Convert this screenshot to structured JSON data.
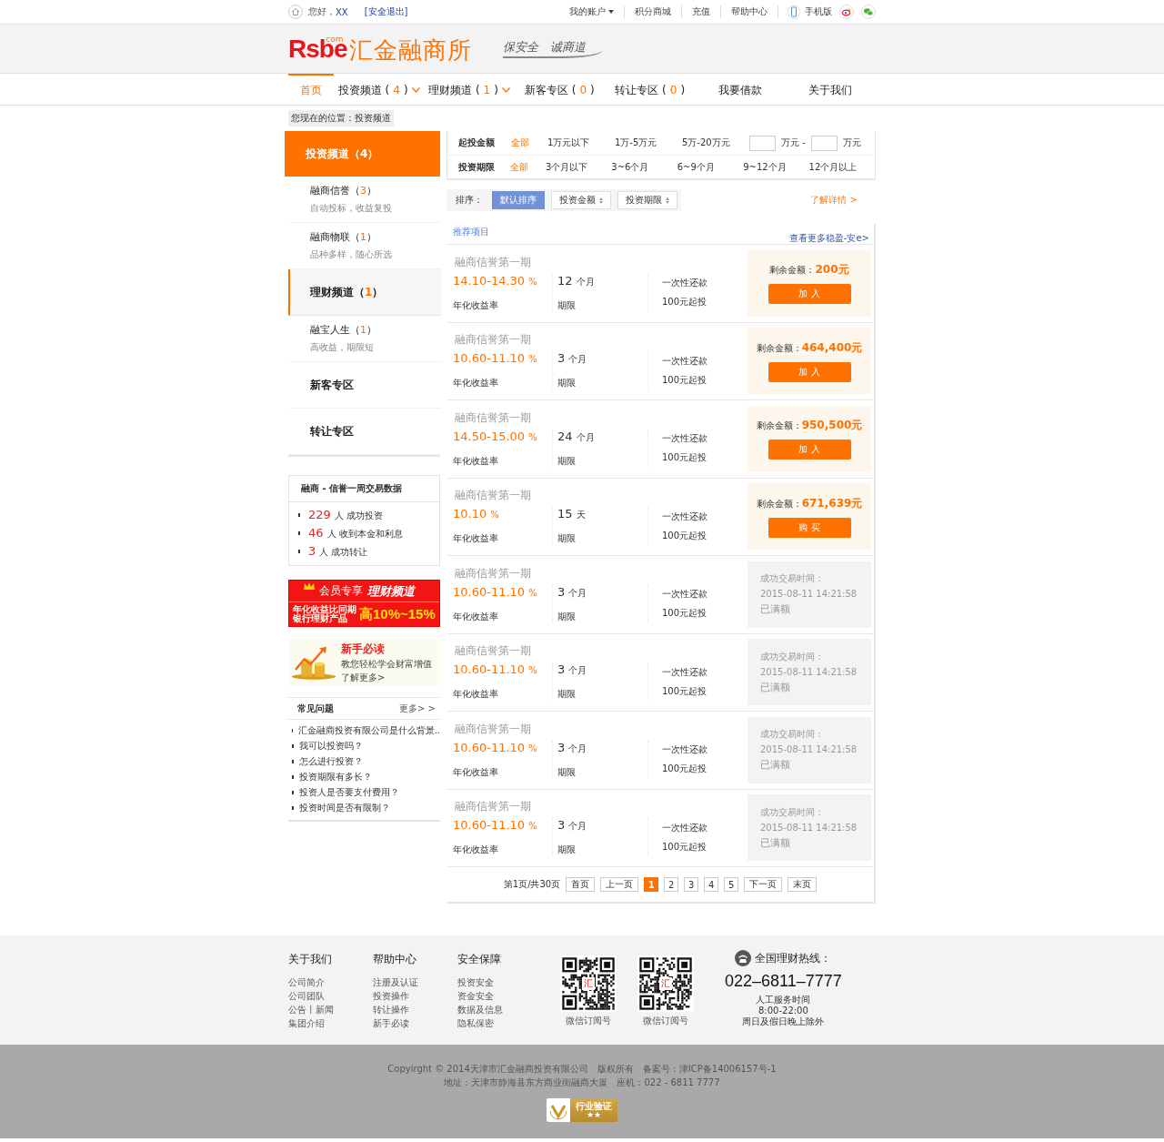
{
  "top_bar": {
    "greeting": "您好，",
    "user": "XX",
    "logout": "[安全退出]",
    "links": [
      {
        "label": "我的账户",
        "dropdown": true
      },
      {
        "label": "积分商城",
        "dropdown": false
      },
      {
        "label": "充值",
        "dropdown": false
      },
      {
        "label": "帮助中心",
        "dropdown": false
      }
    ],
    "mobile": "手机版"
  },
  "logo": {
    "brand": "Rsbe",
    "domain": ".com",
    "name": "汇金融商所",
    "slogan": "保安全　诚商道"
  },
  "nav": {
    "items": [
      {
        "label": "首页",
        "dropdown": false,
        "selected": true
      },
      {
        "label": "投资频道 (",
        "count": "4",
        "close": ")",
        "dropdown": true,
        "selected": false
      },
      {
        "label": "理财频道 (",
        "count": "1",
        "close": ")",
        "dropdown": true,
        "selected": false
      },
      {
        "label": "新客专区 (",
        "count": "0",
        "close": ")",
        "dropdown": false,
        "selected": false
      },
      {
        "label": "转让专区 (",
        "count": "0",
        "close": ")",
        "dropdown": false,
        "selected": false
      },
      {
        "label": "我要借款",
        "dropdown": false,
        "selected": false
      },
      {
        "label": "关于我们",
        "dropdown": false,
        "selected": false
      }
    ]
  },
  "breadcrumb": "您现在的位置：投资频道",
  "sidebar": {
    "header": {
      "label": "投资频道（",
      "count": "4",
      "close": "）"
    },
    "items": [
      {
        "kind": "sub",
        "title": "融商信誉（",
        "count": "3",
        "close": "）",
        "subtitle": "自动投标，收益复投",
        "selected": false
      },
      {
        "kind": "sub",
        "title": "融商物联（",
        "count": "1",
        "close": "）",
        "subtitle": "品种多样，随心所选",
        "selected": false
      },
      {
        "kind": "channel",
        "title": "理财频道（",
        "count": "1",
        "close": "）",
        "selected": true
      },
      {
        "kind": "sub",
        "title": "融宝人生（",
        "count": "1",
        "close": "）",
        "subtitle": "高收益，期限短",
        "selected": false
      },
      {
        "kind": "channel",
        "title": "新客专区",
        "selected": false
      },
      {
        "kind": "channel",
        "title": "转让专区",
        "selected": false
      }
    ]
  },
  "stats": {
    "title": "融商 - 信誉一周交易数据",
    "rows": [
      {
        "value": "229",
        "label": "人 成功投资"
      },
      {
        "value": "46",
        "label": "人 收到本金和利息"
      },
      {
        "value": "3",
        "label": "人 成功转让"
      }
    ]
  },
  "promo": {
    "tag": "会员专享",
    "title": "理财频道",
    "line1": "年化收益比同期",
    "line2": "银行理财产品",
    "highlight": "高10%~15%"
  },
  "guide": {
    "title": "新手必读",
    "text": "教您轻松学会财富增值",
    "link": "了解更多>"
  },
  "faq": {
    "title": "常见问题",
    "more": "更多> >",
    "items": [
      "汇金融商投资有限公司是什么背景..",
      "我可以投资吗？",
      "怎么进行投资？",
      "投资期限有多长？",
      "投资人是否要支付费用？",
      "投资时间是否有限制？"
    ]
  },
  "filters": [
    {
      "label": "起投金额",
      "options": [
        {
          "label": "全部",
          "selected": true
        },
        {
          "label": "1万元以下",
          "selected": false
        },
        {
          "label": "1万-5万元",
          "selected": false
        },
        {
          "label": "5万-20万元",
          "selected": false
        }
      ],
      "range": {
        "unit_from": "万元 -",
        "unit_to": "万元"
      }
    },
    {
      "label": "投资期限",
      "options": [
        {
          "label": "全部",
          "selected": true
        },
        {
          "label": "3个月以下",
          "selected": false
        },
        {
          "label": "3~6个月",
          "selected": false
        },
        {
          "label": "6~9个月",
          "selected": false
        },
        {
          "label": "9~12个月",
          "selected": false
        },
        {
          "label": "12个月以上",
          "selected": false
        }
      ]
    }
  ],
  "sort": {
    "label": "排序：",
    "buttons": [
      {
        "label": "默认排序",
        "selected": true,
        "arrows": false
      },
      {
        "label": "投资金额",
        "selected": false,
        "arrows": true
      },
      {
        "label": "投资期限",
        "selected": false,
        "arrows": true
      }
    ],
    "details_link": "了解详情 >"
  },
  "section": {
    "title": "推荐项目",
    "more": "查看更多稳盈-安e>"
  },
  "products": [
    {
      "name": "融商信誉第一期",
      "rate": "14.10-14.30",
      "rate_unit": "%",
      "rate_label": "年化收益率",
      "term": "12",
      "term_unit": "个月",
      "term_label": "期限",
      "repay": "一次性还款",
      "min": "100元起投",
      "status": {
        "kind": "open",
        "label": "剩余金额：",
        "amount": "200元",
        "button": "加 入"
      }
    },
    {
      "name": "融商信誉第一期",
      "rate": "10.60-11.10",
      "rate_unit": "%",
      "rate_label": "年化收益率",
      "term": "3",
      "term_unit": "个月",
      "term_label": "期限",
      "repay": "一次性还款",
      "min": "100元起投",
      "status": {
        "kind": "open",
        "label": "剩余金额：",
        "amount": "464,400元",
        "button": "加 入"
      }
    },
    {
      "name": "融商信誉第一期",
      "rate": "14.50-15.00",
      "rate_unit": "%",
      "rate_label": "年化收益率",
      "term": "24",
      "term_unit": "个月",
      "term_label": "期限",
      "repay": "一次性还款",
      "min": "100元起投",
      "status": {
        "kind": "open",
        "label": "剩余金额：",
        "amount": "950,500元",
        "button": "加 入"
      }
    },
    {
      "name": "融商信誉第一期",
      "rate": "10.10",
      "rate_unit": "%",
      "rate_label": "年化收益率",
      "term": "15",
      "term_unit": "天",
      "term_label": "期限",
      "repay": "一次性还款",
      "min": "100元起投",
      "status": {
        "kind": "open",
        "label": "剩余金额：",
        "amount": "671,639元",
        "button": "购 买"
      }
    },
    {
      "name": "融商信誉第一期",
      "rate": "10.60-11.10",
      "rate_unit": "%",
      "rate_label": "年化收益率",
      "term": "3",
      "term_unit": "个月",
      "term_label": "期限",
      "repay": "一次性还款",
      "min": "100元起投",
      "status": {
        "kind": "full",
        "label": "成功交易时间：",
        "time": "2015-08-11 14:21:58",
        "text": "已满额"
      }
    },
    {
      "name": "融商信誉第一期",
      "rate": "10.60-11.10",
      "rate_unit": "%",
      "rate_label": "年化收益率",
      "term": "3",
      "term_unit": "个月",
      "term_label": "期限",
      "repay": "一次性还款",
      "min": "100元起投",
      "status": {
        "kind": "full",
        "label": "成功交易时间：",
        "time": "2015-08-11 14:21:58",
        "text": "已满额"
      }
    },
    {
      "name": "融商信誉第一期",
      "rate": "10.60-11.10",
      "rate_unit": "%",
      "rate_label": "年化收益率",
      "term": "3",
      "term_unit": "个月",
      "term_label": "期限",
      "repay": "一次性还款",
      "min": "100元起投",
      "status": {
        "kind": "full",
        "label": "成功交易时间：",
        "time": "2015-08-11 14:21:58",
        "text": "已满额"
      }
    },
    {
      "name": "融商信誉第一期",
      "rate": "10.60-11.10",
      "rate_unit": "%",
      "rate_label": "年化收益率",
      "term": "3",
      "term_unit": "个月",
      "term_label": "期限",
      "repay": "一次性还款",
      "min": "100元起投",
      "status": {
        "kind": "full",
        "label": "成功交易时间：",
        "time": "2015-08-11 14:21:58",
        "text": "已满额"
      }
    }
  ],
  "pagination": {
    "info": "第1页/共30页",
    "buttons": [
      {
        "label": "首页",
        "selected": false
      },
      {
        "label": "上一页",
        "selected": false
      },
      {
        "label": "1",
        "selected": true
      },
      {
        "label": "2",
        "selected": false
      },
      {
        "label": "3",
        "selected": false
      },
      {
        "label": "4",
        "selected": false
      },
      {
        "label": "5",
        "selected": false
      },
      {
        "label": "下一页",
        "selected": false
      },
      {
        "label": "末页",
        "selected": false
      }
    ]
  },
  "footer": {
    "columns": [
      {
        "title": "关于我们",
        "links": [
          "公司简介",
          "公司团队",
          "公告丨新闻",
          "集团介绍"
        ]
      },
      {
        "title": "帮助中心",
        "links": [
          "注册及认证",
          "投资操作",
          "转让操作",
          "新手必读"
        ]
      },
      {
        "title": "安全保障",
        "links": [
          "投资安全",
          "资金安全",
          "数据及信息",
          "隐私保密"
        ]
      }
    ],
    "qr_codes": [
      {
        "logo": "汇",
        "caption": "微信订阅号"
      },
      {
        "logo": "汇",
        "caption": "微信订阅号"
      }
    ],
    "hotline": {
      "title": "全国理财热线：",
      "phone": "022–6811–7777",
      "lines": [
        "人工服务时间",
        "8:00-22:00",
        "周日及假日晚上除外"
      ]
    },
    "copyright": [
      "Copyirght © 2014天津市汇金融商投资有限公司　版权所有　备案号：津ICP备14006157号-1",
      "地址：天津市静海县东方商业街融商大厦　座机：022 - 6811 7777"
    ],
    "badge": {
      "title": "行业验证",
      "stars": "★★"
    }
  }
}
